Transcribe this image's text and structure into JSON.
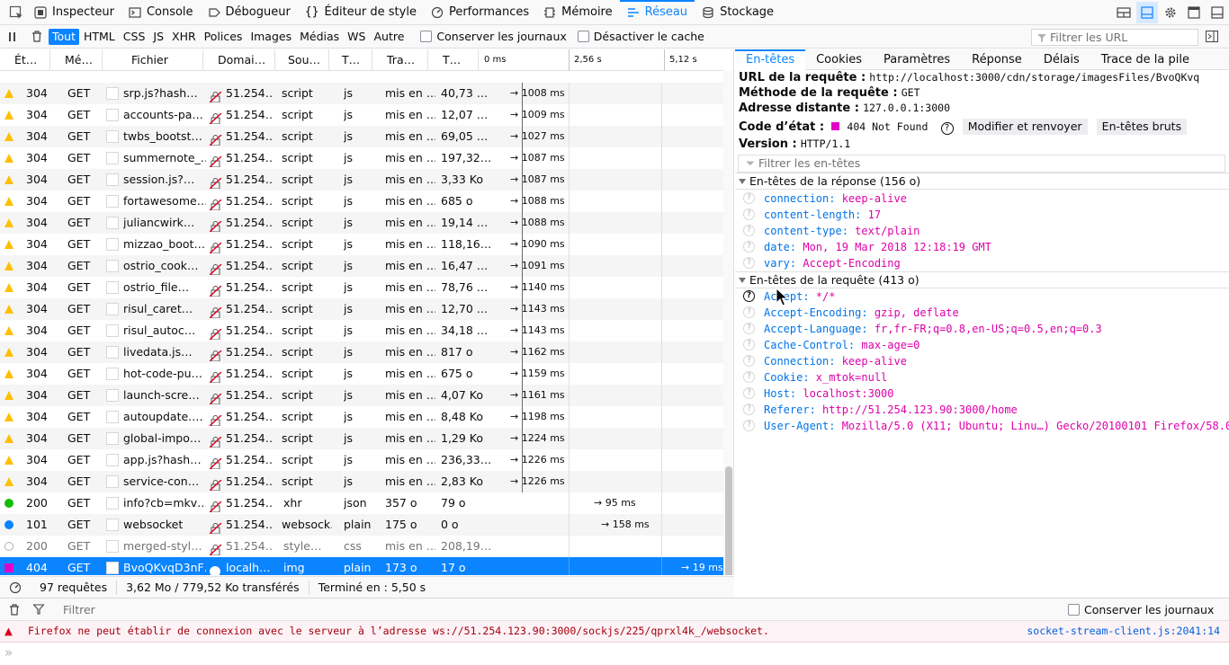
{
  "toolbar": {
    "tabs": [
      {
        "label": "Inspecteur",
        "icon": "inspector-icon"
      },
      {
        "label": "Console",
        "icon": "console-icon"
      },
      {
        "label": "Débogueur",
        "icon": "debugger-icon"
      },
      {
        "label": "Éditeur de style",
        "icon": "style-editor-icon"
      },
      {
        "label": "Performances",
        "icon": "performance-icon"
      },
      {
        "label": "Mémoire",
        "icon": "memory-icon"
      },
      {
        "label": "Réseau",
        "icon": "network-icon"
      },
      {
        "label": "Stockage",
        "icon": "storage-icon"
      }
    ],
    "selected": "Réseau"
  },
  "filterbar": {
    "types": [
      "Tout",
      "HTML",
      "CSS",
      "JS",
      "XHR",
      "Polices",
      "Images",
      "Médias",
      "WS",
      "Autre"
    ],
    "selected_type": "Tout",
    "persist_logs": "Conserver les journaux",
    "disable_cache": "Désactiver le cache",
    "url_filter_placeholder": "Filtrer les URL"
  },
  "table": {
    "headers": [
      "Ét…",
      "Mé…",
      "Fichier",
      "Domai…",
      "Sou…",
      "T…",
      "Tra…",
      "T…"
    ],
    "waterfall_ticks": [
      "0 ms",
      "2,56 s",
      "5,12 s"
    ],
    "rows": [
      {
        "kind": "warn",
        "status": "304",
        "method": "GET",
        "file": "srp.js?hash…",
        "domain": "51.254…",
        "cause": "script",
        "type": "js",
        "transferred": "mis en …",
        "size": "40,73 …",
        "timing": "→ 1008 ms"
      },
      {
        "kind": "warn",
        "status": "304",
        "method": "GET",
        "file": "accounts-pa…",
        "domain": "51.254…",
        "cause": "script",
        "type": "js",
        "transferred": "mis en …",
        "size": "12,07 …",
        "timing": "→ 1009 ms"
      },
      {
        "kind": "warn",
        "status": "304",
        "method": "GET",
        "file": "twbs_bootst…",
        "domain": "51.254…",
        "cause": "script",
        "type": "js",
        "transferred": "mis en …",
        "size": "69,05 …",
        "timing": "→ 1027 ms"
      },
      {
        "kind": "warn",
        "status": "304",
        "method": "GET",
        "file": "summernote_…",
        "domain": "51.254…",
        "cause": "script",
        "type": "js",
        "transferred": "mis en …",
        "size": "197,32…",
        "timing": "→ 1087 ms"
      },
      {
        "kind": "warn",
        "status": "304",
        "method": "GET",
        "file": "session.js?…",
        "domain": "51.254…",
        "cause": "script",
        "type": "js",
        "transferred": "mis en …",
        "size": "3,33 Ko",
        "timing": "→ 1087 ms"
      },
      {
        "kind": "warn",
        "status": "304",
        "method": "GET",
        "file": "fortawesome…",
        "domain": "51.254…",
        "cause": "script",
        "type": "js",
        "transferred": "mis en …",
        "size": "685 o",
        "timing": "→ 1088 ms"
      },
      {
        "kind": "warn",
        "status": "304",
        "method": "GET",
        "file": "juliancwirk…",
        "domain": "51.254…",
        "cause": "script",
        "type": "js",
        "transferred": "mis en …",
        "size": "19,14 …",
        "timing": "→ 1088 ms"
      },
      {
        "kind": "warn",
        "status": "304",
        "method": "GET",
        "file": "mizzao_boot…",
        "domain": "51.254…",
        "cause": "script",
        "type": "js",
        "transferred": "mis en …",
        "size": "118,16…",
        "timing": "→ 1090 ms"
      },
      {
        "kind": "warn",
        "status": "304",
        "method": "GET",
        "file": "ostrio_cook…",
        "domain": "51.254…",
        "cause": "script",
        "type": "js",
        "transferred": "mis en …",
        "size": "16,47 …",
        "timing": "→ 1091 ms"
      },
      {
        "kind": "warn",
        "status": "304",
        "method": "GET",
        "file": "ostrio_file…",
        "domain": "51.254…",
        "cause": "script",
        "type": "js",
        "transferred": "mis en …",
        "size": "78,76 …",
        "timing": "→ 1140 ms"
      },
      {
        "kind": "warn",
        "status": "304",
        "method": "GET",
        "file": "risul_caret…",
        "domain": "51.254…",
        "cause": "script",
        "type": "js",
        "transferred": "mis en …",
        "size": "12,70 …",
        "timing": "→ 1143 ms"
      },
      {
        "kind": "warn",
        "status": "304",
        "method": "GET",
        "file": "risul_autoc…",
        "domain": "51.254…",
        "cause": "script",
        "type": "js",
        "transferred": "mis en …",
        "size": "34,18 …",
        "timing": "→ 1143 ms"
      },
      {
        "kind": "warn",
        "status": "304",
        "method": "GET",
        "file": "livedata.js…",
        "domain": "51.254…",
        "cause": "script",
        "type": "js",
        "transferred": "mis en …",
        "size": "817 o",
        "timing": "→ 1162 ms"
      },
      {
        "kind": "warn",
        "status": "304",
        "method": "GET",
        "file": "hot-code-pu…",
        "domain": "51.254…",
        "cause": "script",
        "type": "js",
        "transferred": "mis en …",
        "size": "675 o",
        "timing": "→ 1159 ms"
      },
      {
        "kind": "warn",
        "status": "304",
        "method": "GET",
        "file": "launch-scre…",
        "domain": "51.254…",
        "cause": "script",
        "type": "js",
        "transferred": "mis en …",
        "size": "4,07 Ko",
        "timing": "→ 1161 ms"
      },
      {
        "kind": "warn",
        "status": "304",
        "method": "GET",
        "file": "autoupdate.…",
        "domain": "51.254…",
        "cause": "script",
        "type": "js",
        "transferred": "mis en …",
        "size": "8,48 Ko",
        "timing": "→ 1198 ms"
      },
      {
        "kind": "warn",
        "status": "304",
        "method": "GET",
        "file": "global-impo…",
        "domain": "51.254…",
        "cause": "script",
        "type": "js",
        "transferred": "mis en …",
        "size": "1,29 Ko",
        "timing": "→ 1224 ms"
      },
      {
        "kind": "warn",
        "status": "304",
        "method": "GET",
        "file": "app.js?hash…",
        "domain": "51.254…",
        "cause": "script",
        "type": "js",
        "transferred": "mis en …",
        "size": "236,33…",
        "timing": "→ 1226 ms"
      },
      {
        "kind": "warn",
        "status": "304",
        "method": "GET",
        "file": "service-con…",
        "domain": "51.254…",
        "cause": "script",
        "type": "js",
        "transferred": "mis en …",
        "size": "2,83 Ko",
        "timing": "→ 1226 ms"
      },
      {
        "kind": "ok",
        "status": "200",
        "method": "GET",
        "file": "info?cb=mkv…",
        "domain": "51.254…",
        "cause": "xhr",
        "type": "json",
        "transferred": "357 o",
        "size": "79 o",
        "timing": "→ 95 ms"
      },
      {
        "kind": "info",
        "status": "101",
        "method": "GET",
        "file": "websocket",
        "domain": "51.254…",
        "cause": "websock…",
        "type": "plain",
        "transferred": "175 o",
        "size": "0 o",
        "timing": "→ 158 ms"
      },
      {
        "kind": "cached",
        "status": "200",
        "method": "GET",
        "file": "merged-styl…",
        "domain": "51.254…",
        "cause": "style…",
        "type": "css",
        "transferred": "mis en …",
        "size": "208,19…",
        "timing": ""
      },
      {
        "kind": "error",
        "status": "404",
        "method": "GET",
        "file": "BvoQKvqD3nF…",
        "domain": "localh…",
        "cause": "img",
        "type": "plain",
        "transferred": "173 o",
        "size": "17 o",
        "timing": "→ 19 ms"
      }
    ]
  },
  "summary": {
    "requests": "97 requêtes",
    "transferred": "3,62 Mo / 779,52 Ko transférés",
    "finished": "Terminé en : 5,50 s"
  },
  "details": {
    "tabs": [
      "En-têtes",
      "Cookies",
      "Paramètres",
      "Réponse",
      "Délais",
      "Trace de la pile"
    ],
    "selected_tab": "En-têtes",
    "url_label": "URL de la requête :",
    "url_value": "http://localhost:3000/cdn/storage/imagesFiles/BvoQKvq",
    "method_label": "Méthode de la requête :",
    "method_value": "GET",
    "remote_label": "Adresse distante :",
    "remote_value": "127.0.0.1:3000",
    "status_label": "Code d’état :",
    "status_value": "404 Not Found",
    "edit_resend": "Modifier et renvoyer",
    "raw_headers": "En-têtes bruts",
    "version_label": "Version :",
    "version_value": "HTTP/1.1",
    "headers_filter_placeholder": "Filtrer les en-têtes",
    "response_section": "En-têtes de la réponse (156 o)",
    "response_headers": [
      {
        "name": "connection:",
        "value": "keep-alive"
      },
      {
        "name": "content-length:",
        "value": "17"
      },
      {
        "name": "content-type:",
        "value": "text/plain"
      },
      {
        "name": "date:",
        "value": "Mon, 19 Mar 2018 12:18:19 GMT"
      },
      {
        "name": "vary:",
        "value": "Accept-Encoding"
      }
    ],
    "request_section": "En-têtes de la requête (413 o)",
    "request_headers": [
      {
        "name": "Accept:",
        "value": "*/*"
      },
      {
        "name": "Accept-Encoding:",
        "value": "gzip, deflate"
      },
      {
        "name": "Accept-Language:",
        "value": "fr,fr-FR;q=0.8,en-US;q=0.5,en;q=0.3"
      },
      {
        "name": "Cache-Control:",
        "value": "max-age=0"
      },
      {
        "name": "Connection:",
        "value": "keep-alive"
      },
      {
        "name": "Cookie:",
        "value": "x_mtok=null"
      },
      {
        "name": "Host:",
        "value": "localhost:3000"
      },
      {
        "name": "Referer:",
        "value": "http://51.254.123.90:3000/home"
      },
      {
        "name": "User-Agent:",
        "value": "Mozilla/5.0 (X11; Ubuntu; Linu…) Gecko/20100101 Firefox/58.0"
      }
    ]
  },
  "console": {
    "filter_placeholder": "Filtrer",
    "persist_logs": "Conserver les journaux",
    "error_message": "Firefox ne peut établir de connexion avec le serveur à l’adresse ws://51.254.123.90:3000/sockjs/225/qprxl4k_/websocket.",
    "error_source": "socket-stream-client.js:2041:14"
  },
  "colors": {
    "accent": "#0a84ff",
    "warning": "#ffbf00",
    "success": "#12bc00",
    "info": "#0a84ff",
    "error_status": "#e100c7",
    "header_name": "#0074e8",
    "header_value": "#dd00a9",
    "console_error_text": "#a4000f"
  }
}
